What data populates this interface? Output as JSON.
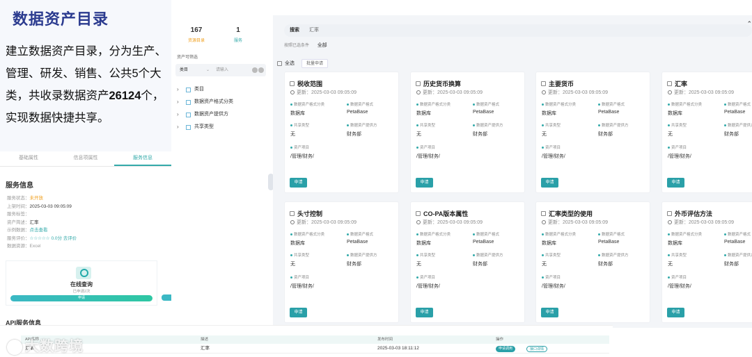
{
  "slide": {
    "title": "数据资产目录",
    "body_before": "建立数据资产目录，分为生产、管理、研发、销售、公共5个大类，共收录数据资产",
    "body_number": "26124",
    "body_after": "个，实现数据快捷共享。"
  },
  "bg": {
    "tabs": [
      "基础属性",
      "信息项属性",
      "服务信息"
    ],
    "service_title": "服务信息",
    "service_rows": [
      {
        "k": "服务状态：",
        "v": "未开放"
      },
      {
        "k": "上架时间：",
        "v": "2025-03-03 09:05:09"
      },
      {
        "k": "服务标签：",
        "v": ""
      },
      {
        "k": "资产简述：",
        "v": "汇率"
      },
      {
        "k": "示例数据：",
        "v": "点击查看"
      },
      {
        "k": "服务评价：",
        "v": "☆☆☆☆☆ 0.0分 去评价"
      },
      {
        "k": "数据资源：",
        "v": "Excel"
      }
    ],
    "query_title": "在线查询",
    "query_sub": "已申请2次",
    "query_btn": "申请",
    "api_title": "API服务信息",
    "api_table": {
      "headers": [
        "API名称",
        "描述",
        "发布时间",
        "操作"
      ],
      "row": {
        "name": "汇率",
        "desc": "汇率",
        "time": "2025-03-03 18:11:12",
        "btn1": "申请调用",
        "btn2": "接口详情"
      }
    }
  },
  "sidebar": {
    "stats": [
      {
        "num": "167",
        "label": "资源目录"
      },
      {
        "num": "1",
        "label": "服务"
      }
    ],
    "filter_label": "资产可筛选",
    "filter_select": "类目",
    "filter_input": "请输入",
    "tree": [
      "类目",
      "数据资产格式分类",
      "数据资产提供方",
      "共享类型"
    ]
  },
  "main": {
    "search_tag": "搜索",
    "search_value": "汇率",
    "cond_label": "按照已选条件",
    "cond_value": "全部",
    "select_all": "全选",
    "batch": "批量申请",
    "field_labels": {
      "format_cat": "数据资产格式分类",
      "format": "数据资产格式",
      "share": "共享类型",
      "provider": "数据资产提供方",
      "item": "资产项目"
    },
    "apply_label": "申请",
    "cards": [
      {
        "title": "税收范围",
        "updated": "更新：2025-03-03 09:05:09",
        "format_cat": "数据库",
        "format": "PetaBase",
        "share": "无",
        "provider": "财务部",
        "item": "/管理/财务/"
      },
      {
        "title": "历史货币换算",
        "updated": "更新：2025-03-03 09:05:09",
        "format_cat": "数据库",
        "format": "PetaBase",
        "share": "无",
        "provider": "财务部",
        "item": "/管理/财务/"
      },
      {
        "title": "主要货币",
        "updated": "更新：2025-03-03 09:05:09",
        "format_cat": "数据库",
        "format": "PetaBase",
        "share": "无",
        "provider": "财务部",
        "item": "/管理/财务/"
      },
      {
        "title": "汇率",
        "updated": "更新：2025-03-03 09:05:09",
        "format_cat": "数据库",
        "format": "PetaBase",
        "share": "无",
        "provider": "财务部",
        "item": "/管理/财务/"
      },
      {
        "title": "头寸控制",
        "updated": "更新：2025-03-03 09:05:09",
        "format_cat": "数据库",
        "format": "PetaBase",
        "share": "无",
        "provider": "财务部",
        "item": "/管理/财务/"
      },
      {
        "title": "CO-PA版本属性",
        "updated": "更新：2025-03-03 09:05:09",
        "format_cat": "数据库",
        "format": "PetaBase",
        "share": "无",
        "provider": "财务部",
        "item": "/管理/财务/"
      },
      {
        "title": "汇率类型的使用",
        "updated": "更新：2025-03-03 09:05:09",
        "format_cat": "数据库",
        "format": "PetaBase",
        "share": "无",
        "provider": "财务部",
        "item": "/管理/财务/"
      },
      {
        "title": "外币评估方法",
        "updated": "更新：2025-03-03 09:05:09",
        "format_cat": "数据库",
        "format": "PetaBase",
        "share": "无",
        "provider": "财务部",
        "item": "/管理/财务/"
      }
    ]
  },
  "watermark": "大数跨境",
  "colors": {
    "accent": "#2aa0a8",
    "title": "#2b3b8f",
    "warn": "#f0a020"
  }
}
